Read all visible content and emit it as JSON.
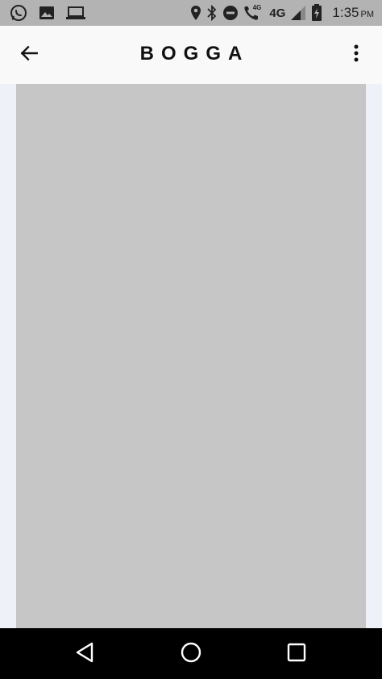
{
  "status_bar": {
    "left_icons": [
      "whatsapp-icon",
      "gallery-icon",
      "laptop-icon"
    ],
    "right_icons": [
      "location-icon",
      "bluetooth-icon",
      "do-not-disturb-icon",
      "volte-call-icon",
      "network-4g-icon",
      "signal-icon",
      "battery-charging-icon"
    ],
    "volte_label": "4G",
    "network_label": "4G",
    "time": "1:35",
    "ampm": "PM"
  },
  "app_bar": {
    "title": "BOGGA",
    "back_icon": "arrow-back-icon",
    "menu_icon": "more-vert-icon"
  },
  "nav_bar": {
    "icons": [
      "back-triangle-icon",
      "home-circle-icon",
      "recents-square-icon"
    ]
  },
  "colors": {
    "status_bar_bg": "#b3b3b3",
    "app_bar_bg": "#f9f9f9",
    "content_bg": "#eef2f8",
    "placeholder_bg": "#c6c6c6",
    "nav_bar_bg": "#000000"
  }
}
